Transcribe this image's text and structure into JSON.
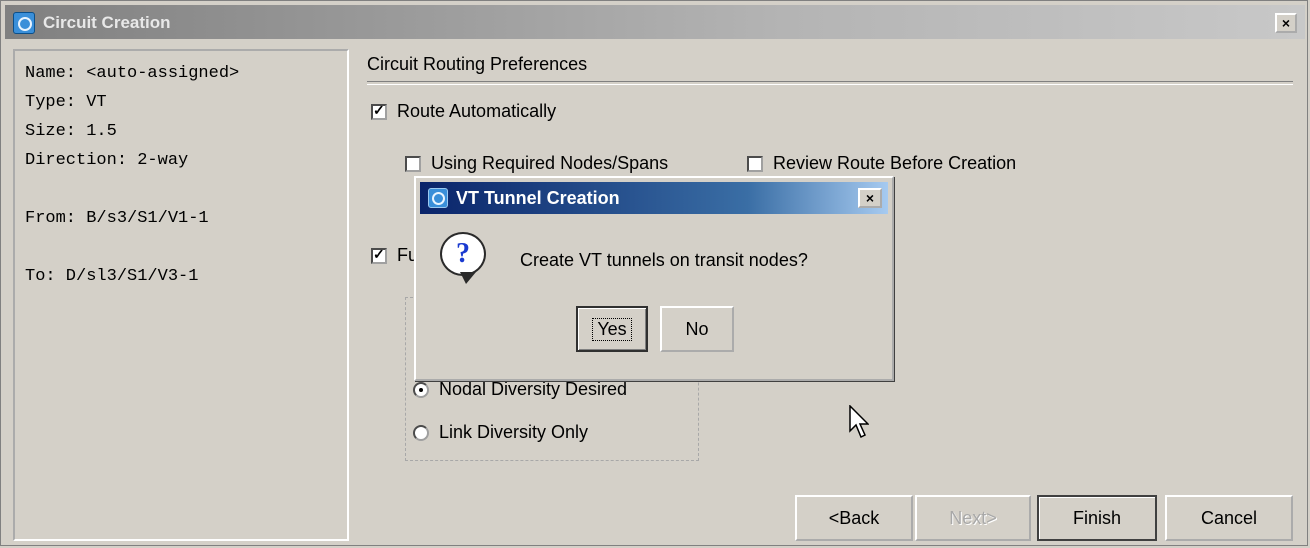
{
  "window": {
    "title": "Circuit Creation",
    "close_glyph": "×"
  },
  "summary": {
    "name": "Name: <auto-assigned>",
    "type": "Type: VT",
    "size": "Size: 1.5",
    "direction": "Direction: 2-way",
    "from": "From: B/s3/S1/V1-1",
    "to": "To: D/sl3/S1/V3-1"
  },
  "routing": {
    "section_title": "Circuit Routing Preferences",
    "route_automatically": {
      "label": "Route Automatically",
      "checked": true
    },
    "using_required_nodes": {
      "label": "Using Required Nodes/Spans",
      "checked": false
    },
    "review_route": {
      "label": "Review Route Before Creation",
      "checked": false
    },
    "fully_protected": {
      "label": "Fu",
      "checked": true
    },
    "diversity_options": [
      {
        "label": "Nodal Diversity Desired",
        "selected": true
      },
      {
        "label": "Link Diversity Only",
        "selected": false
      }
    ]
  },
  "wizard_buttons": {
    "back": "<Back",
    "next": "Next>",
    "finish": "Finish",
    "cancel": "Cancel"
  },
  "dialog": {
    "title": "VT Tunnel Creation",
    "close_glyph": "×",
    "message": "Create VT tunnels on transit nodes?",
    "icon": "question-icon",
    "yes": "Yes",
    "no": "No"
  },
  "colors": {
    "window_bg": "#d4d0c8",
    "dialog_title_start": "#0a246a",
    "dialog_title_end": "#a6caf0"
  }
}
